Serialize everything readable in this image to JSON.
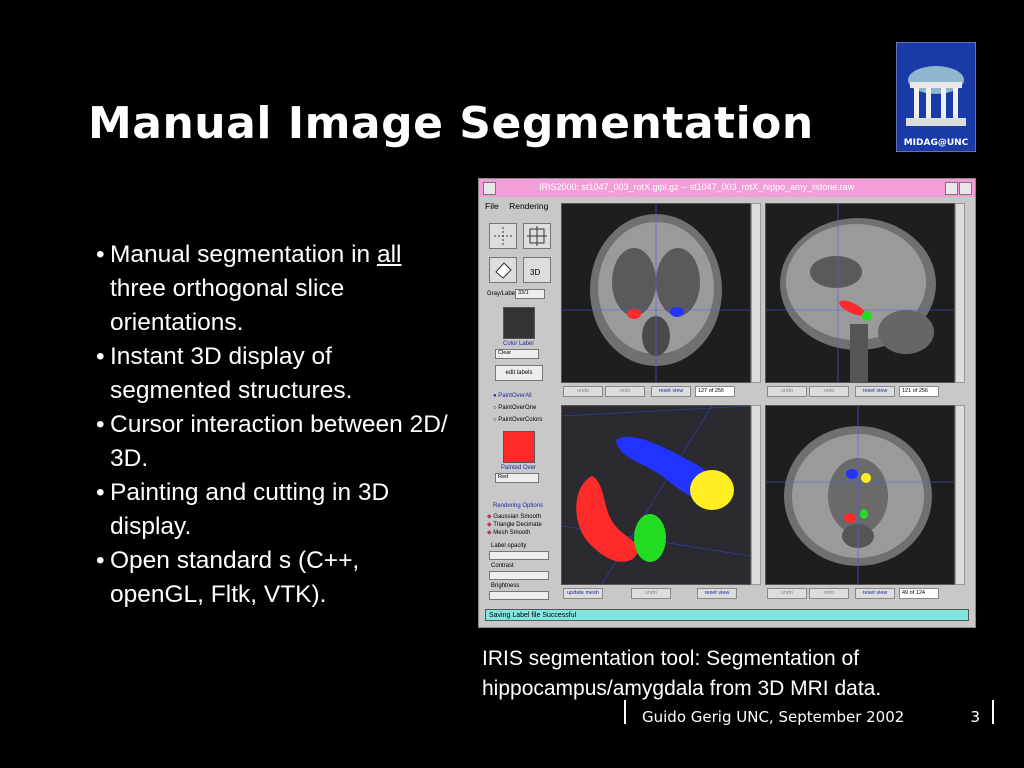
{
  "slide": {
    "title": "Manual Image Segmentation",
    "bullets": [
      {
        "pre": "Manual segmentation in ",
        "underline": "all",
        "post": " three orthogonal slice orientations."
      },
      {
        "text": "Instant 3D display of segmented structures."
      },
      {
        "text": "Cursor interaction between 2D/ 3D."
      },
      {
        "text": "Painting and cutting in 3D display."
      },
      {
        "text": "Open standard s (C++, openGL, Fltk, VTK)."
      }
    ],
    "caption": "IRIS segmentation tool: Segmentation of hippocampus/amygdala from 3D MRI data.",
    "footer": {
      "text": "Guido Gerig UNC, September 2002",
      "page": "3"
    },
    "logo_text": "MIDAG@UNC"
  },
  "iris": {
    "title": "IRIS2000: st1047_003_rotX.gipl.gz -- st1047_003_rotX_hippo_amy_ridone.raw",
    "menu": [
      "File",
      "Rendering"
    ],
    "tool_3d": "3D",
    "gray_label": "Gray/Label",
    "gray_value": "33/1",
    "color_label": "Color Label",
    "color_value": "Clear",
    "edit_labels": "edit labels",
    "paint_modes": [
      "PaintOverAll",
      "PaintOverOne",
      "PaintOverColors"
    ],
    "painted_over": "Painted Over",
    "painted_value": "Red",
    "rendering_options": "Rendering Options",
    "render_items": [
      "Gaussian Smooth",
      "Triangle Decimate",
      "Mesh Smooth"
    ],
    "sliders": [
      "Label opacity",
      "Contrast",
      "Brightness"
    ],
    "panels": {
      "top_left": {
        "buttons": [
          "undo",
          "redo",
          "reset view"
        ],
        "slice": "127 of 256"
      },
      "top_right": {
        "buttons": [
          "undo",
          "redo",
          "reset view"
        ],
        "slice": "121 of 256"
      },
      "bottom_left": {
        "buttons": [
          "update mesh",
          "undo",
          "reset view"
        ]
      },
      "bottom_right": {
        "buttons": [
          "undo",
          "redo",
          "reset view"
        ],
        "slice": "49 of 124"
      }
    },
    "status": "Saving Label file Successful"
  },
  "colors": {
    "background": "#000000",
    "titlebar": "#f29fd9",
    "status": "#7fe6e0",
    "red": "#ff2a2a",
    "blue": "#2233ff",
    "green": "#22dd22",
    "yellow": "#ffee22"
  }
}
